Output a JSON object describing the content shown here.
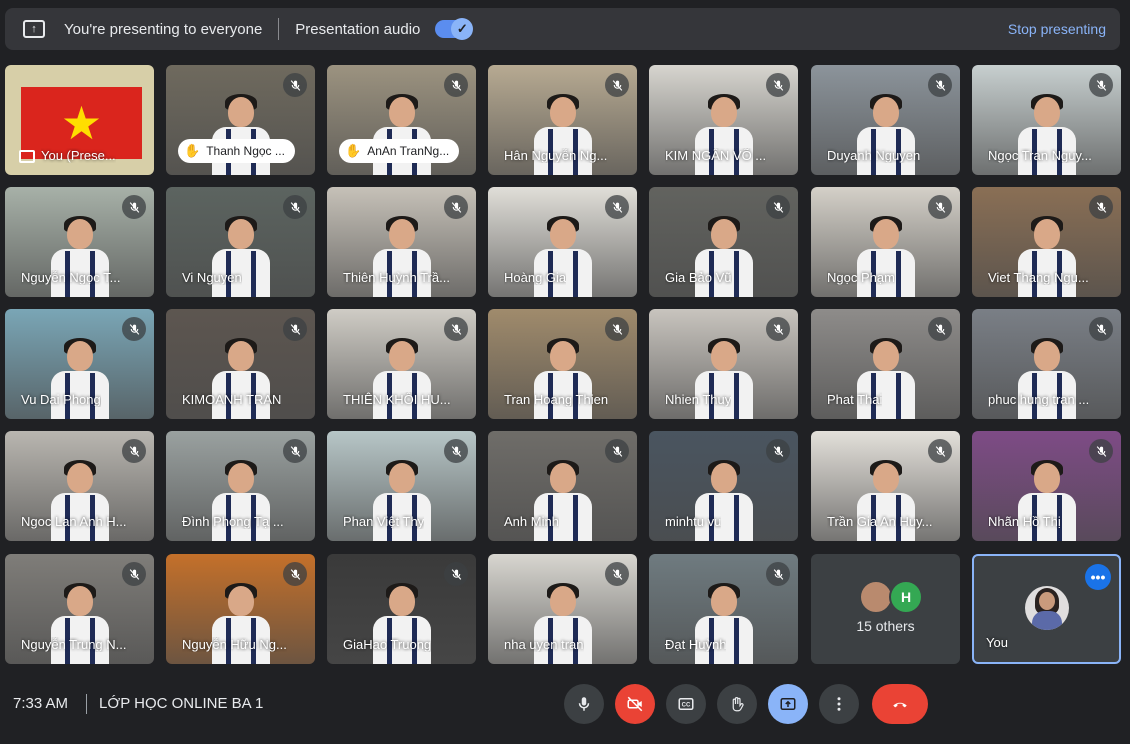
{
  "banner": {
    "presenting_text": "You're presenting to everyone",
    "audio_label": "Presentation audio",
    "stop_label": "Stop presenting"
  },
  "tiles": [
    {
      "name": "You (Prese...",
      "type": "presentation"
    },
    {
      "name": "Thanh Ngọc ...",
      "type": "pill"
    },
    {
      "name": "AnAn TranNg...",
      "type": "pill"
    },
    {
      "name": "Hân Nguyễn Ng...",
      "type": "video"
    },
    {
      "name": "KIM NGÂN VÕ ...",
      "type": "video"
    },
    {
      "name": "Duyanh Nguyen",
      "type": "video"
    },
    {
      "name": "Ngọc Tran Nguy...",
      "type": "video"
    },
    {
      "name": "Nguyễn Ngọc T...",
      "type": "video"
    },
    {
      "name": "Vi Nguyen",
      "type": "video"
    },
    {
      "name": "Thiên Huỳnh Trầ...",
      "type": "video"
    },
    {
      "name": "Hoàng Gia",
      "type": "video"
    },
    {
      "name": "Gia Bảo Vũ",
      "type": "video"
    },
    {
      "name": "Ngọc Phạm",
      "type": "video"
    },
    {
      "name": "Viet Thang Ngu...",
      "type": "video"
    },
    {
      "name": "Vu Dai Phong",
      "type": "video"
    },
    {
      "name": "KIMOANH TRAN",
      "type": "video"
    },
    {
      "name": "THIÊN KHÔI HU...",
      "type": "video"
    },
    {
      "name": "Tran Hoang Thien",
      "type": "video"
    },
    {
      "name": "Nhien Thuy",
      "type": "video"
    },
    {
      "name": "Phat Thai",
      "type": "video"
    },
    {
      "name": "phuc hung tran ...",
      "type": "video"
    },
    {
      "name": "Ngoc Lan Anh H...",
      "type": "video"
    },
    {
      "name": "Đình Phong Tạ ...",
      "type": "video"
    },
    {
      "name": "Phan Việt Thy",
      "type": "video"
    },
    {
      "name": "Anh Minh",
      "type": "video"
    },
    {
      "name": "minhtu vu",
      "type": "video"
    },
    {
      "name": "Trần Gia An Huy...",
      "type": "video"
    },
    {
      "name": "Nhãn Hồ Thị",
      "type": "video"
    },
    {
      "name": "Nguyễn Trung N...",
      "type": "video"
    },
    {
      "name": "Nguyễn Hữu Ng...",
      "type": "video"
    },
    {
      "name": "GiaHao Truong",
      "type": "video"
    },
    {
      "name": "nha uyen tran",
      "type": "video"
    },
    {
      "name": "Đạt Huỳnh",
      "type": "video"
    },
    {
      "name": "15 others",
      "type": "others",
      "avatar_letter": "H"
    },
    {
      "name": "You",
      "type": "self"
    }
  ],
  "bottom": {
    "time": "7:33 AM",
    "meeting_name": "LỚP HỌC ONLINE BA 1"
  },
  "colors": {
    "background": "#202124",
    "accent_blue": "#8ab4f8",
    "danger_red": "#ea4335"
  }
}
